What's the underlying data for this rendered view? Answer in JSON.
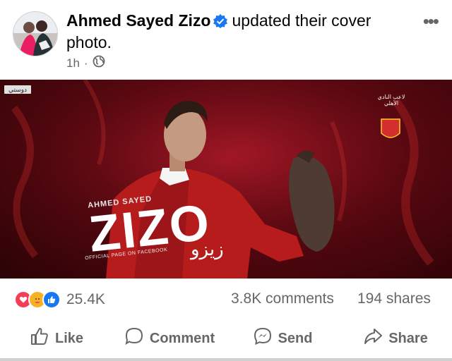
{
  "post": {
    "author": "Ahmed Sayed Zizo",
    "action": "updated their cover photo.",
    "time": "1h",
    "privacy_icon": "globe-icon",
    "more_icon": "more-options-icon"
  },
  "cover": {
    "channel_logo": "دوستي",
    "subtitle": "AHMED SAYED",
    "name": "ZIZO",
    "tagline": "OFFICIAL PAGE ON FACEBOOK",
    "signature": "زيزو",
    "club_text": "لاعب النادي الأهلي"
  },
  "stats": {
    "reactions": [
      "love",
      "care",
      "like"
    ],
    "reaction_count": "25.4K",
    "comments": "3.8K comments",
    "shares": "194 shares"
  },
  "actions": {
    "like": "Like",
    "comment": "Comment",
    "send": "Send",
    "share": "Share"
  },
  "colors": {
    "brand_blue": "#1877f2",
    "love_red": "#f33e58",
    "care_yellow": "#f7b125",
    "secondary_text": "#65676b",
    "cover_red": "#7a0c18"
  }
}
